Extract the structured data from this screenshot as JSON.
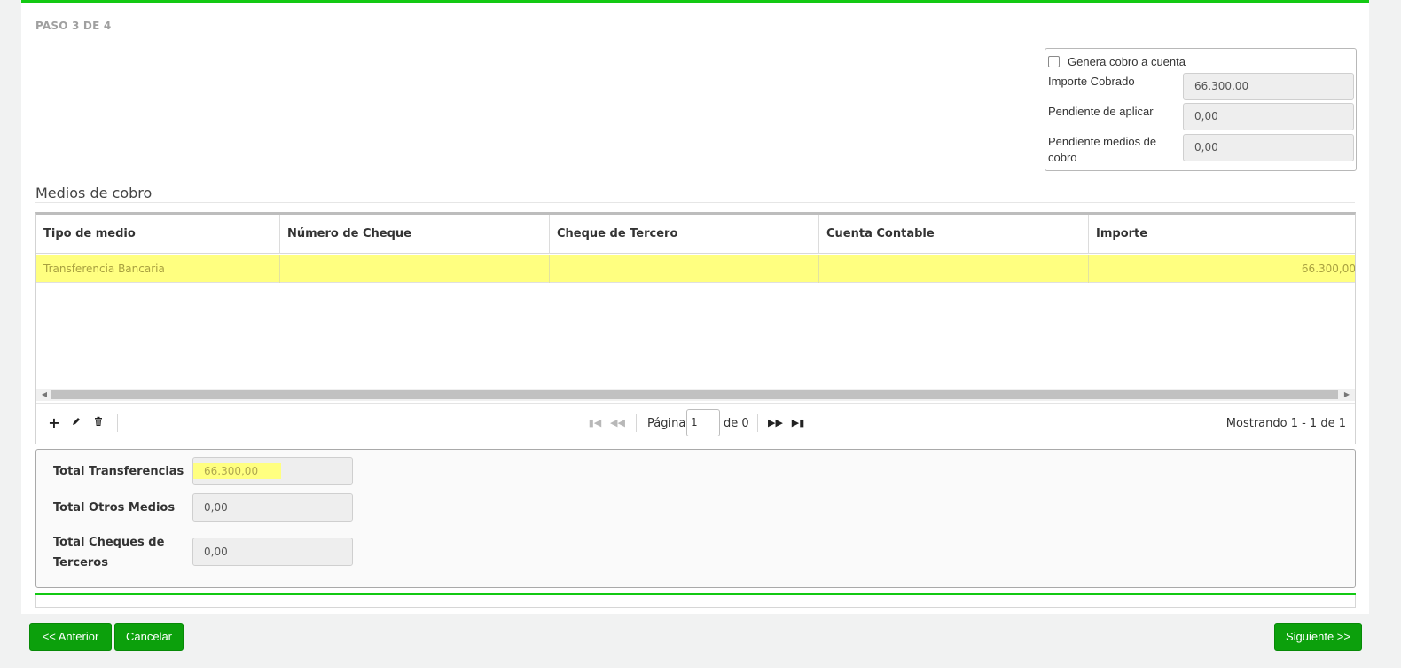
{
  "step": {
    "title": "PASO 3 DE 4"
  },
  "summary": {
    "generate_label": "Genera cobro a cuenta",
    "generate_checked": false,
    "fields": [
      {
        "label": "Importe Cobrado",
        "value": "66.300,00"
      },
      {
        "label": "Pendiente de aplicar",
        "value": "0,00"
      },
      {
        "label": "Pendiente medios de cobro",
        "value": "0,00"
      }
    ]
  },
  "section": {
    "title": "Medios de cobro"
  },
  "grid": {
    "columns": [
      "Tipo de medio",
      "Número de Cheque",
      "Cheque de Tercero",
      "Cuenta Contable",
      "Importe"
    ],
    "rows": [
      {
        "tipo": "Transferencia Bancaria",
        "numero": "",
        "tercero": "",
        "cuenta": "",
        "importe": "66.300,00"
      }
    ]
  },
  "pager": {
    "page_label": "Página",
    "page_value": "1",
    "of_label": "de 0",
    "info": "Mostrando 1 - 1 de 1"
  },
  "totals": [
    {
      "label": "Total Transferencias",
      "value": "66.300,00"
    },
    {
      "label": "Total Otros Medios",
      "value": "0,00"
    },
    {
      "label": "Total Cheques de Terceros",
      "value": "0,00"
    }
  ],
  "buttons": {
    "previous": "<< Anterior",
    "cancel": "Cancelar",
    "next": "Siguiente >>"
  },
  "colors": {
    "accent_green": "#13c913",
    "button_green": "#0ca00c",
    "highlight": "#ffff80"
  }
}
